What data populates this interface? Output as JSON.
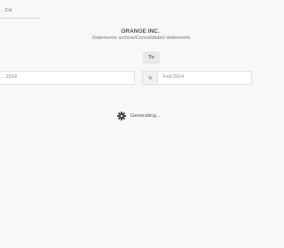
{
  "search": {
    "placeholder": "…CH"
  },
  "header": {
    "company": "ORANGE INC.",
    "subtitle": "Statements archive/Consolidated statements"
  },
  "range": {
    "to_label": "To",
    "from_value": "…2014",
    "to_value": "Feb'2014",
    "from_icon": "tag-icon",
    "to_icon": "tag-icon"
  },
  "status": {
    "icon": "gear-icon",
    "text": "Generating..."
  }
}
